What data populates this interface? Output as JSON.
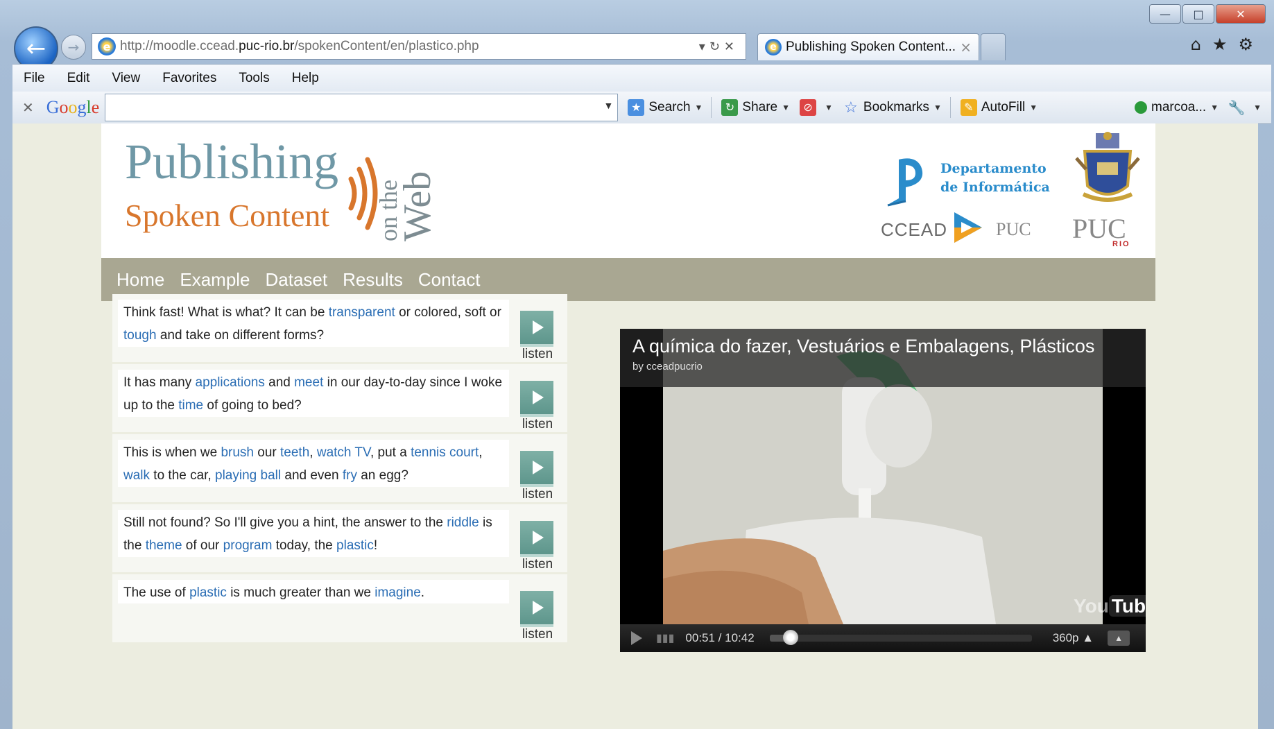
{
  "browser": {
    "address_url_prefix": "http://moodle.ccead.",
    "address_url_domain": "puc-rio.br",
    "address_url_suffix": "/spokenContent/en/plastico.php",
    "tab_title": "Publishing Spoken Content...",
    "tab_close": "×",
    "menu": [
      "File",
      "Edit",
      "View",
      "Favorites",
      "Tools",
      "Help"
    ],
    "google_toolbar": {
      "logo": "Google",
      "search_label": "Search",
      "share_label": "Share",
      "bookmarks_label": "Bookmarks",
      "autofill_label": "AutoFill",
      "user_label": "marcoa..."
    }
  },
  "site": {
    "logo": {
      "publishing": "Publishing",
      "spoken_content": "Spoken Content",
      "on_the": "on the",
      "web": "Web"
    },
    "partners": {
      "dept_line1": "Departamento",
      "dept_line2": "de Informática",
      "ccead": "CCEAD",
      "puc_small": "PUC",
      "puc_big": "PUC",
      "puc_rio": "RIO"
    },
    "nav": [
      "Home",
      "Example",
      "Dataset",
      "Results",
      "Contact"
    ]
  },
  "sentences": [
    {
      "parts": [
        {
          "t": "Think fast! What is what? It can be "
        },
        {
          "t": "transparent",
          "link": true
        },
        {
          "t": " or colored, soft or "
        },
        {
          "t": "tough",
          "link": true
        },
        {
          "t": " and take on different forms?"
        }
      ],
      "listen": "listen"
    },
    {
      "parts": [
        {
          "t": "It has many "
        },
        {
          "t": "applications",
          "link": true
        },
        {
          "t": " and "
        },
        {
          "t": "meet",
          "link": true
        },
        {
          "t": " in our day-to-day since I woke up to the "
        },
        {
          "t": "time",
          "link": true
        },
        {
          "t": " of going to bed?"
        }
      ],
      "listen": "listen"
    },
    {
      "parts": [
        {
          "t": "This is when we "
        },
        {
          "t": "brush",
          "link": true
        },
        {
          "t": " our "
        },
        {
          "t": "teeth",
          "link": true
        },
        {
          "t": ", "
        },
        {
          "t": "watch TV",
          "link": true
        },
        {
          "t": ", put a "
        },
        {
          "t": "tennis court",
          "link": true
        },
        {
          "t": ", "
        },
        {
          "t": "walk",
          "link": true
        },
        {
          "t": " to the car, "
        },
        {
          "t": "playing ball",
          "link": true
        },
        {
          "t": " and even "
        },
        {
          "t": "fry",
          "link": true
        },
        {
          "t": " an egg?"
        }
      ],
      "listen": "listen"
    },
    {
      "parts": [
        {
          "t": "Still not found? So I'll give you a hint, the answer to the "
        },
        {
          "t": "riddle",
          "link": true
        },
        {
          "t": " is the "
        },
        {
          "t": "theme",
          "link": true
        },
        {
          "t": " of our "
        },
        {
          "t": "program",
          "link": true
        },
        {
          "t": " today, the "
        },
        {
          "t": "plastic",
          "link": true
        },
        {
          "t": "!"
        }
      ],
      "listen": "listen"
    },
    {
      "parts": [
        {
          "t": "The use of "
        },
        {
          "t": "plastic",
          "link": true
        },
        {
          "t": " is much greater than we "
        },
        {
          "t": "imagine",
          "link": true
        },
        {
          "t": "."
        }
      ],
      "listen": "listen"
    }
  ],
  "video": {
    "title": "A química do fazer, Vestuários e Embalagens, Plásticos",
    "by": "by cceadpucrio",
    "time": "00:51 / 10:42",
    "progress": 0.081,
    "quality": "360p",
    "yt_you": "You",
    "yt_tube": "Tube"
  },
  "colors": {
    "link": "#2a6db4",
    "nav_bg": "#a9a792",
    "logo_blue": "#6f98a6",
    "logo_orange": "#d8762c"
  }
}
